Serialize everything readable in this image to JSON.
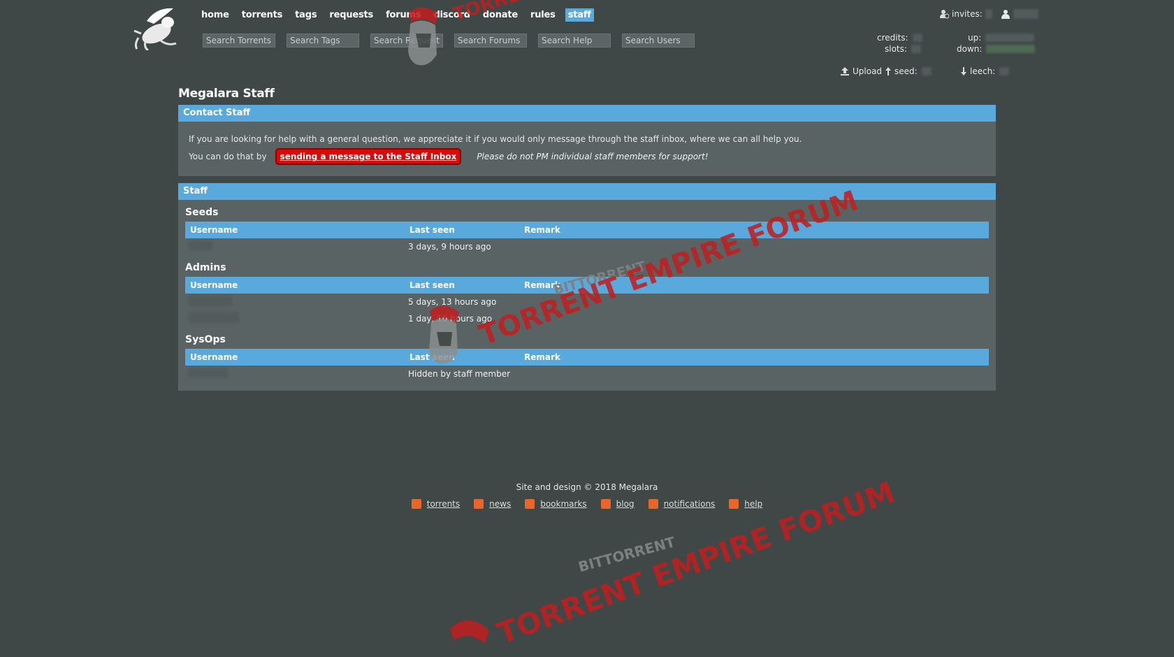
{
  "header": {
    "nav": [
      {
        "label": "home",
        "active": false
      },
      {
        "label": "torrents",
        "active": false
      },
      {
        "label": "tags",
        "active": false
      },
      {
        "label": "requests",
        "active": false
      },
      {
        "label": "forums",
        "active": false
      },
      {
        "label": "discord",
        "active": false
      },
      {
        "label": "donate",
        "active": false
      },
      {
        "label": "rules",
        "active": false
      },
      {
        "label": "staff",
        "active": true
      }
    ],
    "searches": [
      {
        "placeholder": "Search Torrents"
      },
      {
        "placeholder": "Search Tags"
      },
      {
        "placeholder": "Search Requests"
      },
      {
        "placeholder": "Search Forums"
      },
      {
        "placeholder": "Search Help"
      },
      {
        "placeholder": "Search Users"
      }
    ],
    "userbar": {
      "invites_label": "invites:",
      "credits_label": "credits:",
      "slots_label": "slots:",
      "up_label": "up:",
      "down_label": "down:",
      "upload_label": "Upload",
      "seed_label": "seed:",
      "leech_label": "leech:"
    }
  },
  "page": {
    "title": "Megalara Staff",
    "contact": {
      "header": "Contact Staff",
      "line1": "If you are looking for help with a general question, we appreciate it if you would only message through the staff inbox, where we can all help you.",
      "line2_prefix": "You can do that by",
      "button": "sending a message to the Staff Inbox",
      "note": "Please do not PM individual staff members for support!"
    },
    "staff": {
      "header": "Staff",
      "columns": {
        "username": "Username",
        "last_seen": "Last seen",
        "remark": "Remark"
      },
      "groups": [
        {
          "title": "Seeds",
          "rows": [
            {
              "last_seen": "3 days, 9 hours ago",
              "remark": ""
            }
          ]
        },
        {
          "title": "Admins",
          "rows": [
            {
              "last_seen": "5 days, 13 hours ago",
              "remark": ""
            },
            {
              "last_seen": "1 day, 10 hours ago",
              "remark": ""
            }
          ]
        },
        {
          "title": "SysOps",
          "rows": [
            {
              "last_seen": "Hidden by staff member",
              "remark": ""
            }
          ]
        }
      ]
    }
  },
  "footer": {
    "copyright": "Site and design © 2018 Megalara",
    "links": [
      "torrents",
      "news",
      "bookmarks",
      "blog",
      "notifications",
      "help"
    ]
  },
  "watermark": {
    "small_text": "BITTORRENT",
    "big_text": "TORRENT EMPIRE FORUM"
  },
  "colors": {
    "background": "#3f4747",
    "accent": "#5aa9dd",
    "panel": "#5a6363",
    "button_red": "#d70a0a",
    "watermark_red": "#c21d1d",
    "rss_orange": "#e8662a"
  }
}
